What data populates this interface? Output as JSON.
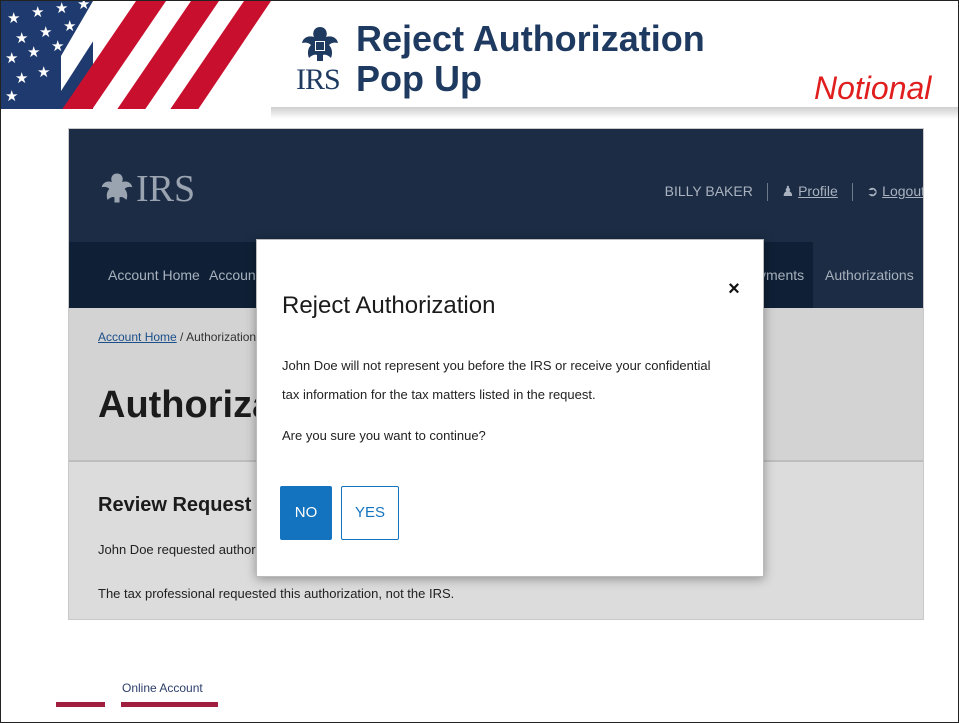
{
  "slide": {
    "title_line1": "Reject Authorization",
    "title_line2": "Pop Up",
    "notional": "Notional",
    "logo_text": "IRS",
    "footer_label": "Online Account"
  },
  "colors": {
    "title": "#1f3a60",
    "notional": "#e01e1e",
    "footer_bar": "#a01f3f",
    "site_header": "#1b2c44",
    "site_nav": "#0f2036",
    "button_primary": "#1473be"
  },
  "site": {
    "logo_text": "IRS",
    "user_name": "BILLY BAKER",
    "profile_label": "Profile",
    "logout_label": "Logout",
    "nav": {
      "home": "Account Home",
      "account_partial": "Account E",
      "payments_partial": "yments",
      "authorizations": "Authorizations"
    },
    "breadcrumb": {
      "home": "Account Home",
      "separator": "/",
      "current": "Authorizations"
    },
    "heading_partial": "Authorizatio",
    "review": {
      "title_partial": "Review Request for",
      "line1_partial": "John Doe requested authorizat",
      "line2": "The tax professional requested this authorization, not the IRS."
    }
  },
  "modal": {
    "title": "Reject Authorization",
    "close_symbol": "×",
    "body": "John Doe will not represent you before the IRS or receive your confidential tax information for the tax matters listed in the request.",
    "question": "Are you sure you want to continue?",
    "no_label": "NO",
    "yes_label": "YES"
  }
}
